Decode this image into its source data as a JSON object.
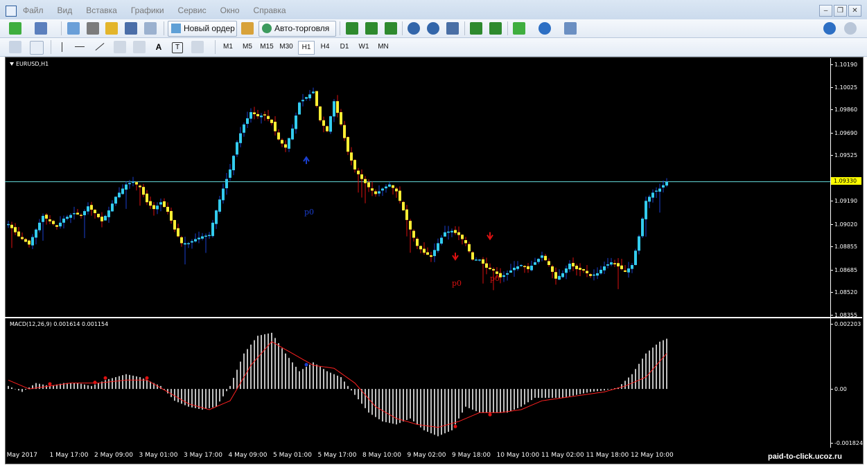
{
  "window": {
    "menu": [
      "Файл",
      "Вид",
      "Вставка",
      "Графики",
      "Сервис",
      "Окно",
      "Справка"
    ]
  },
  "toolbar": {
    "new_order": "Новый ордер",
    "auto_trading": "Авто-торговля"
  },
  "timeframes": [
    "M1",
    "M5",
    "M15",
    "M30",
    "H1",
    "H4",
    "D1",
    "W1",
    "MN"
  ],
  "active_timeframe": "H1",
  "chart": {
    "symbol_label": "EURUSD,H1",
    "current_price": "1.09330",
    "price_axis": [
      "1.10190",
      "1.10025",
      "1.09860",
      "1.09690",
      "1.09525",
      "1.09190",
      "1.09020",
      "1.08855",
      "1.08685",
      "1.08520",
      "1.08355"
    ],
    "time_axis": [
      "1 May 2017",
      "1 May 17:00",
      "2 May 09:00",
      "3 May 01:00",
      "3 May 17:00",
      "4 May 09:00",
      "5 May 01:00",
      "5 May 17:00",
      "8 May 10:00",
      "9 May 02:00",
      "9 May 18:00",
      "10 May 10:00",
      "11 May 02:00",
      "11 May 18:00",
      "12 May 10:00"
    ],
    "p0_label": "p0",
    "colors": {
      "bull": "#33ccee",
      "bear": "#ffee33",
      "wick_bull": "#1a3fd0",
      "wick_bear": "#dd1111",
      "bg": "#000000",
      "hline": "#66dddd",
      "signal": "#ff2020",
      "hist": "#c0c0c0"
    }
  },
  "macd": {
    "label": "MACD(12,26,9) 0.001614 0.001154",
    "axis": [
      "0.002203",
      "0.00",
      "-0.001824"
    ]
  },
  "watermark": "paid-to-click.ucoz.ru",
  "chart_data": {
    "type": "candlestick",
    "symbol": "EURUSD",
    "timeframe": "H1",
    "ylim": [
      1.08355,
      1.1019
    ],
    "close_path": [
      [
        0,
        1.0902
      ],
      [
        3,
        1.0893
      ],
      [
        6,
        1.0887
      ],
      [
        8,
        1.0898
      ],
      [
        10,
        1.0908
      ],
      [
        12,
        1.0904
      ],
      [
        14,
        1.09
      ],
      [
        16,
        1.0906
      ],
      [
        19,
        1.091
      ],
      [
        21,
        1.0908
      ],
      [
        23,
        1.0915
      ],
      [
        25,
        1.091
      ],
      [
        27,
        1.0904
      ],
      [
        29,
        1.0912
      ],
      [
        31,
        1.0922
      ],
      [
        34,
        1.0931
      ],
      [
        36,
        1.0933
      ],
      [
        38,
        1.0929
      ],
      [
        40,
        1.0918
      ],
      [
        42,
        1.0913
      ],
      [
        44,
        1.0918
      ],
      [
        46,
        1.0911
      ],
      [
        48,
        1.0898
      ],
      [
        50,
        1.0888
      ],
      [
        52,
        1.0888
      ],
      [
        54,
        1.0891
      ],
      [
        56,
        1.0893
      ],
      [
        58,
        1.0894
      ],
      [
        60,
        1.0912
      ],
      [
        62,
        1.0928
      ],
      [
        64,
        1.0942
      ],
      [
        66,
        1.0962
      ],
      [
        68,
        1.0975
      ],
      [
        70,
        1.0984
      ],
      [
        72,
        1.0981
      ],
      [
        74,
        1.0982
      ],
      [
        76,
        1.0976
      ],
      [
        78,
        1.0964
      ],
      [
        80,
        1.0958
      ],
      [
        82,
        1.0972
      ],
      [
        84,
        1.0991
      ],
      [
        86,
        1.0995
      ],
      [
        88,
        1.0999
      ],
      [
        90,
        1.0978
      ],
      [
        92,
        1.097
      ],
      [
        94,
        1.0992
      ],
      [
        96,
        1.0975
      ],
      [
        98,
        1.0955
      ],
      [
        100,
        1.0942
      ],
      [
        102,
        1.0935
      ],
      [
        104,
        1.0929
      ],
      [
        106,
        1.0924
      ],
      [
        108,
        1.0928
      ],
      [
        110,
        1.0931
      ],
      [
        112,
        1.0926
      ],
      [
        114,
        1.0912
      ],
      [
        116,
        1.0898
      ],
      [
        118,
        1.0886
      ],
      [
        120,
        1.0881
      ],
      [
        122,
        1.0878
      ],
      [
        124,
        1.0888
      ],
      [
        126,
        1.0896
      ],
      [
        128,
        1.0897
      ],
      [
        130,
        1.0894
      ],
      [
        132,
        1.0888
      ],
      [
        134,
        1.0876
      ],
      [
        136,
        1.0876
      ],
      [
        138,
        1.087
      ],
      [
        140,
        1.0868
      ],
      [
        142,
        1.0863
      ],
      [
        144,
        1.0866
      ],
      [
        146,
        1.087
      ],
      [
        148,
        1.0872
      ],
      [
        150,
        1.0869
      ],
      [
        152,
        1.0874
      ],
      [
        154,
        1.0879
      ],
      [
        156,
        1.0872
      ],
      [
        158,
        1.0862
      ],
      [
        160,
        1.0866
      ],
      [
        162,
        1.0873
      ],
      [
        164,
        1.0869
      ],
      [
        166,
        1.0868
      ],
      [
        168,
        1.0864
      ],
      [
        170,
        1.0866
      ],
      [
        172,
        1.0871
      ],
      [
        174,
        1.0874
      ],
      [
        176,
        1.0871
      ],
      [
        178,
        1.0867
      ],
      [
        180,
        1.0872
      ],
      [
        182,
        1.0893
      ],
      [
        184,
        1.0919
      ],
      [
        186,
        1.0925
      ],
      [
        188,
        1.0928
      ],
      [
        190,
        1.0933
      ]
    ],
    "macd_hist_path": [
      [
        0,
        0.0001
      ],
      [
        4,
        -0.0001
      ],
      [
        8,
        0.0002
      ],
      [
        12,
        0.0001
      ],
      [
        16,
        0.0002
      ],
      [
        20,
        0.0002
      ],
      [
        24,
        0.0001
      ],
      [
        28,
        0.0003
      ],
      [
        34,
        0.0005
      ],
      [
        38,
        0.0004
      ],
      [
        44,
        0.0001
      ],
      [
        48,
        -0.0004
      ],
      [
        52,
        -0.0006
      ],
      [
        56,
        -0.0007
      ],
      [
        60,
        -0.0006
      ],
      [
        64,
        0.0001
      ],
      [
        68,
        0.0012
      ],
      [
        72,
        0.0018
      ],
      [
        76,
        0.0019
      ],
      [
        80,
        0.0012
      ],
      [
        84,
        0.0006
      ],
      [
        88,
        0.0009
      ],
      [
        92,
        0.0006
      ],
      [
        96,
        0.0004
      ],
      [
        100,
        -0.0002
      ],
      [
        104,
        -0.0008
      ],
      [
        108,
        -0.0011
      ],
      [
        112,
        -0.0012
      ],
      [
        116,
        -0.001
      ],
      [
        120,
        -0.0014
      ],
      [
        124,
        -0.0016
      ],
      [
        128,
        -0.0014
      ],
      [
        132,
        -0.0006
      ],
      [
        136,
        -0.0008
      ],
      [
        140,
        -0.0008
      ],
      [
        144,
        -0.0008
      ],
      [
        148,
        -0.0006
      ],
      [
        152,
        -0.0003
      ],
      [
        156,
        -0.0003
      ],
      [
        160,
        -0.0003
      ],
      [
        164,
        -0.0002
      ],
      [
        168,
        -0.0001
      ],
      [
        172,
        -5e-05
      ],
      [
        176,
        5e-05
      ],
      [
        180,
        0.0005
      ],
      [
        184,
        0.0012
      ],
      [
        188,
        0.0016
      ],
      [
        190,
        0.0017
      ]
    ],
    "macd_signal_path": [
      [
        0,
        0.0003
      ],
      [
        6,
        0.0
      ],
      [
        12,
        0.0001
      ],
      [
        18,
        0.0002
      ],
      [
        26,
        0.0002
      ],
      [
        34,
        0.0003
      ],
      [
        40,
        0.0003
      ],
      [
        46,
        -0.0001
      ],
      [
        52,
        -0.0005
      ],
      [
        58,
        -0.0007
      ],
      [
        64,
        -0.0004
      ],
      [
        70,
        0.0008
      ],
      [
        76,
        0.0016
      ],
      [
        82,
        0.0012
      ],
      [
        88,
        0.0008
      ],
      [
        94,
        0.0007
      ],
      [
        100,
        0.0002
      ],
      [
        106,
        -0.0006
      ],
      [
        112,
        -0.001
      ],
      [
        118,
        -0.0012
      ],
      [
        124,
        -0.0013
      ],
      [
        130,
        -0.0011
      ],
      [
        136,
        -0.0008
      ],
      [
        142,
        -0.0008
      ],
      [
        148,
        -0.0007
      ],
      [
        154,
        -0.0004
      ],
      [
        160,
        -0.0003
      ],
      [
        166,
        -0.0002
      ],
      [
        172,
        -0.0001
      ],
      [
        178,
        0.0001
      ],
      [
        184,
        0.0004
      ],
      [
        190,
        0.0012
      ]
    ],
    "macd_ylim": [
      -0.001824,
      0.002203
    ]
  }
}
